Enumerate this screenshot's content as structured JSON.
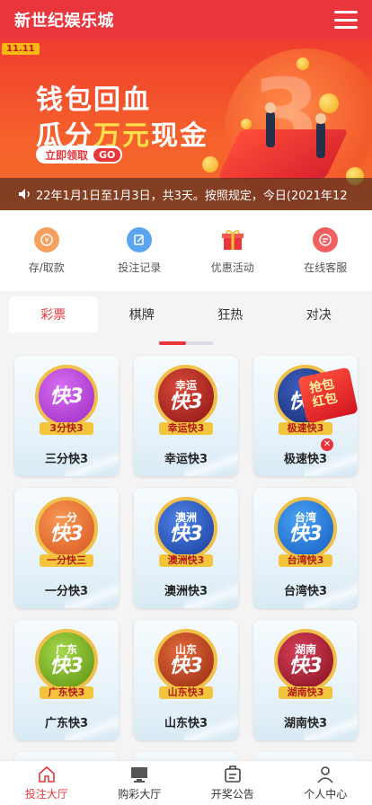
{
  "header": {
    "title": "新世纪娱乐城"
  },
  "banner": {
    "tag": "11.11",
    "line1": "钱包回血",
    "line2_a": "瓜分",
    "line2_b": "万元",
    "line2_c": "现金",
    "cta": "立即领取",
    "cta_go": "GO"
  },
  "notice": {
    "text": "22年1月1日至1月3日，共3天。按照规定，今日(2021年12"
  },
  "quick_actions": [
    {
      "label": "存/取款",
      "icon": "deposit-withdraw-icon",
      "color": "#f08a4b"
    },
    {
      "label": "投注记录",
      "icon": "bet-record-icon",
      "color": "#3d8ee8"
    },
    {
      "label": "优惠活动",
      "icon": "gift-icon",
      "color": "#e8363c"
    },
    {
      "label": "在线客服",
      "icon": "chat-icon",
      "color": "#e8363c"
    }
  ],
  "tabs": [
    {
      "label": "彩票",
      "active": true
    },
    {
      "label": "棋牌",
      "active": false
    },
    {
      "label": "狂热",
      "active": false
    },
    {
      "label": "对决",
      "active": false
    }
  ],
  "games": [
    {
      "name": "三分快3",
      "logo_pre": "",
      "logo_main": "快3",
      "ribbon": "3分快3",
      "color": "#9a2bc4"
    },
    {
      "name": "幸运快3",
      "logo_pre": "幸运",
      "logo_main": "快3",
      "ribbon": "幸运快3",
      "color": "#a81e1e"
    },
    {
      "name": "极速快3",
      "logo_pre": "极",
      "logo_main": "快3",
      "ribbon": "极速快3",
      "color": "#1e3a8a"
    },
    {
      "name": "一分快3",
      "logo_pre": "一分",
      "logo_main": "快3",
      "ribbon": "一分快三",
      "color": "#e8632a"
    },
    {
      "name": "澳洲快3",
      "logo_pre": "澳洲",
      "logo_main": "快3",
      "ribbon": "澳洲快3",
      "color": "#1f4fbf"
    },
    {
      "name": "台湾快3",
      "logo_pre": "台湾",
      "logo_main": "快3",
      "ribbon": "台湾快3",
      "color": "#1d6fd8"
    },
    {
      "name": "广东快3",
      "logo_pre": "广东",
      "logo_main": "快3",
      "ribbon": "广东快3",
      "color": "#6aa316"
    },
    {
      "name": "山东快3",
      "logo_pre": "山东",
      "logo_main": "快3",
      "ribbon": "山东快3",
      "color": "#b0361a"
    },
    {
      "name": "湖南快3",
      "logo_pre": "湖南",
      "logo_main": "快3",
      "ribbon": "湖南快3",
      "color": "#a01a2a"
    }
  ],
  "red_packet": {
    "line1": "抢包",
    "line2": "红包"
  },
  "bottom_nav": [
    {
      "label": "投注大厅",
      "icon": "home-icon",
      "active": true
    },
    {
      "label": "购彩大厅",
      "icon": "monitor-icon",
      "active": false
    },
    {
      "label": "开奖公告",
      "icon": "notice-icon",
      "active": false
    },
    {
      "label": "个人中心",
      "icon": "user-icon",
      "active": false
    }
  ]
}
